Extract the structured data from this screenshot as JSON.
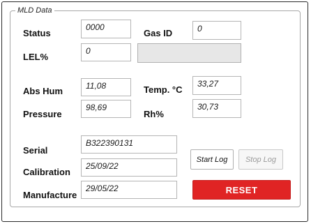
{
  "panel": {
    "title": "MLD Data"
  },
  "labels": {
    "status": "Status",
    "gas_id": "Gas ID",
    "lel": "LEL%",
    "abs_hum": "Abs Hum",
    "temp": "Temp. °C",
    "pressure": "Pressure",
    "rh": "Rh%",
    "serial": "Serial",
    "calibration": "Calibration",
    "manufacture": "Manufacture"
  },
  "values": {
    "status": "0000",
    "gas_id": "0",
    "lel": "0",
    "lel_extra": "",
    "abs_hum": "11,08",
    "temp": "33,27",
    "pressure": "98,69",
    "rh": "30,73",
    "serial": "B322390131",
    "calibration": "25/09/22",
    "manufacture": "29/05/22"
  },
  "buttons": {
    "start_log": "Start Log",
    "stop_log": "Stop Log",
    "reset": "RESET"
  },
  "colors": {
    "reset_bg": "#e02424",
    "disabled_text": "#9a9a9a",
    "readonly_field_bg": "#e7e7e7"
  }
}
